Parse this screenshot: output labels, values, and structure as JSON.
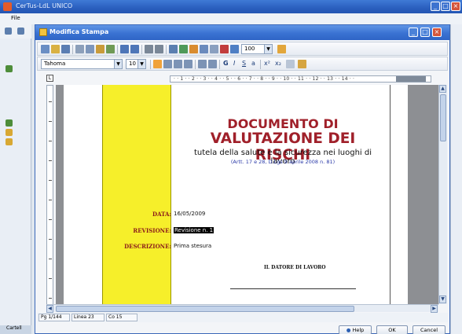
{
  "app": {
    "title": "CerTus-LdL  UNICO",
    "menu_file": "File",
    "left_bottom_tab": "Cartell"
  },
  "dialog": {
    "title": "Modifica Stampa",
    "font_name": "Tahoma",
    "font_size": "10",
    "zoom": "100"
  },
  "document": {
    "title_line1": "DOCUMENTO DI",
    "title_line2": "VALUTAZIONE DEI RISCHI",
    "subtitle": "tutela della salute e la sicurezza nei luoghi di lavoro",
    "reference": "(Artt. 17 e 28, D.Lgs 9 aprile 2008 n. 81)",
    "fields": [
      {
        "label": "DATA:",
        "value": "16/05/2009"
      },
      {
        "label": "REVISIONE:",
        "value": "Revisione n. 1"
      },
      {
        "label": "DESCRIZIONE:",
        "value": "Prima stesura"
      }
    ],
    "signature_label": "IL DATORE DI LAVORO"
  },
  "status": {
    "page": "Pg 1/144",
    "line": "Linea 23",
    "column": "Co 15"
  },
  "buttons": {
    "help": "Help",
    "ok": "OK",
    "cancel": "Cancel"
  },
  "colors": {
    "title_red": "#a0202a",
    "band_yellow": "#f6ef2a",
    "field_label": "#8a1a1a"
  }
}
